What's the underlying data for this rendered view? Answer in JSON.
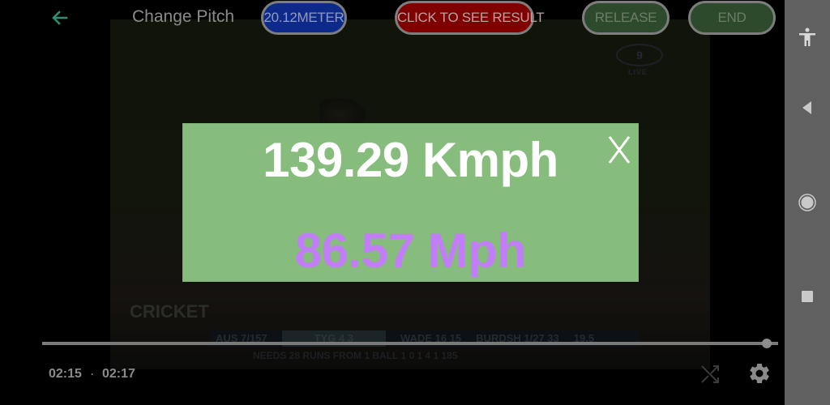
{
  "header": {
    "back_icon": "arrow-left-icon",
    "title": "Change Pitch",
    "buttons": {
      "pitch_length": "20.12METER",
      "see_result": "CLICK TO SEE RESULT",
      "release": "RELEASE",
      "end": "END"
    }
  },
  "video": {
    "channel_logo": "9",
    "channel_live": "LIVE",
    "watermark": "CRICKET",
    "scorebar": {
      "team_score": "AUS 7/157",
      "team_chip": "TYG 4 3",
      "batter": "WADE 16 15",
      "bowler": "BURDSH 1/27 33",
      "overs": "19.5"
    },
    "ticker": "NEEDS 28 RUNS FROM 1 BALL    1 0 1 4 1   185"
  },
  "result_dialog": {
    "speed_kmph": "139.29 Kmph",
    "speed_mph": "86.57 Mph",
    "close_icon": "close-x-icon",
    "colors": {
      "background": "#86bd7c",
      "kmph_text": "#ffffff",
      "mph_text": "#c27ef7"
    }
  },
  "player": {
    "current_time": "02:15",
    "separator": "·",
    "total_time": "02:17",
    "progress_fraction": 0.985,
    "shuffle_icon": "shuffle-icon",
    "settings_icon": "gear-icon"
  },
  "system_nav": {
    "items": [
      "accessibility-icon",
      "back-triangle-icon",
      "home-circle-icon",
      "recents-square-icon"
    ]
  },
  "colors": {
    "pitch_button": "#0d2a8a",
    "result_button": "#800000",
    "release_button": "#2e4a2c",
    "end_button": "#2e4a2c",
    "back_arrow": "#2e8f74",
    "navbar": "#606060"
  }
}
